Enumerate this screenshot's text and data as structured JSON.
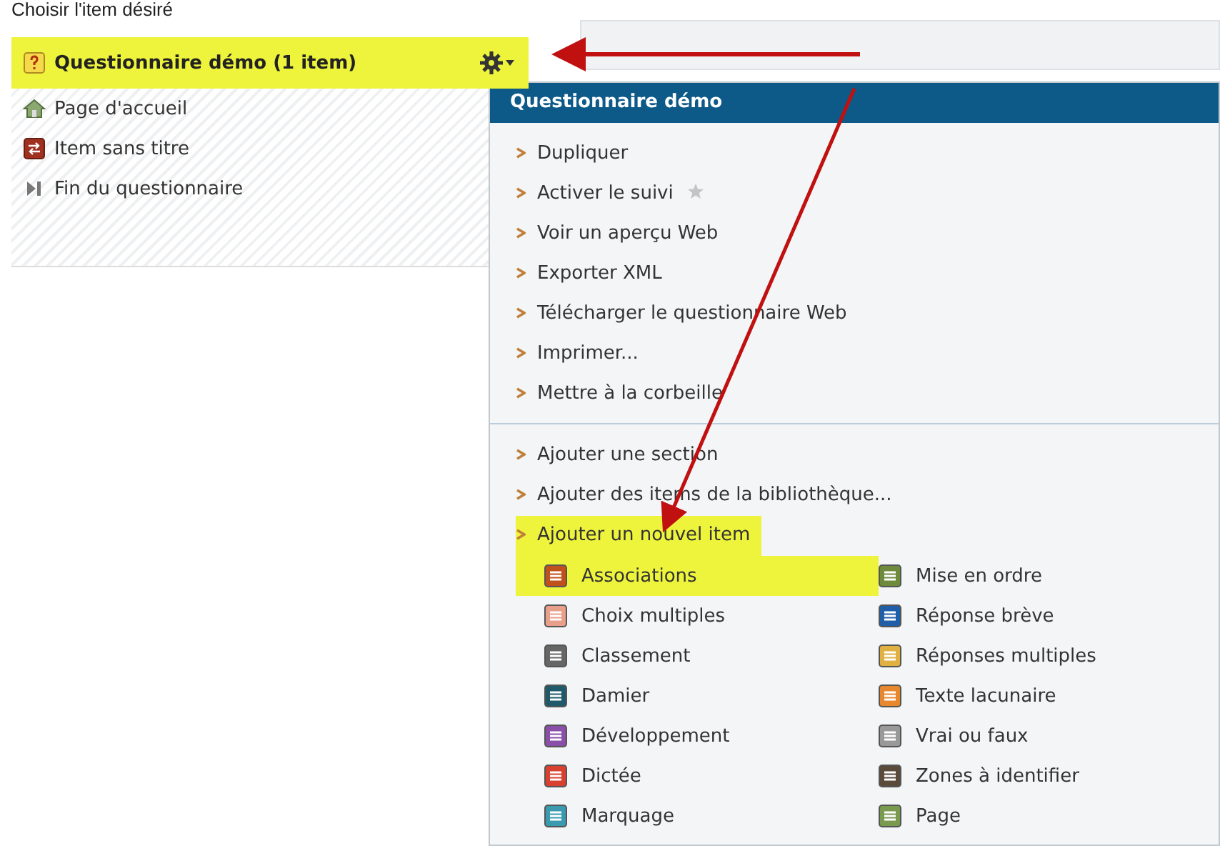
{
  "heading": "Choisir l'item désiré",
  "tree": [
    {
      "label": "Questionnaire démo (1 item)",
      "kind": "quiz",
      "selected": true
    },
    {
      "label": "Page d'accueil",
      "kind": "home",
      "selected": false
    },
    {
      "label": "Item sans titre",
      "kind": "item",
      "selected": false
    },
    {
      "label": "Fin du questionnaire",
      "kind": "end",
      "selected": false
    }
  ],
  "menu": {
    "title": "Questionnaire démo",
    "actions": [
      {
        "label": "Dupliquer",
        "star": false
      },
      {
        "label": "Activer le suivi",
        "star": true
      },
      {
        "label": "Voir un aperçu Web",
        "star": false
      },
      {
        "label": "Exporter XML",
        "star": false
      },
      {
        "label": "Télécharger le questionnaire Web",
        "star": false
      },
      {
        "label": "Imprimer...",
        "star": false
      },
      {
        "label": "Mettre à la corbeille",
        "star": false
      }
    ],
    "add_actions": [
      {
        "label": "Ajouter une section",
        "highlighted": false
      },
      {
        "label": "Ajouter des items de la bibliothèque...",
        "highlighted": false
      },
      {
        "label": "Ajouter un nouvel item",
        "highlighted": true
      }
    ],
    "item_types": [
      {
        "label": "Associations",
        "color": "#c0501c",
        "highlighted": true
      },
      {
        "label": "Mise en ordre",
        "color": "#6e8b3d",
        "highlighted": false
      },
      {
        "label": "Choix multiples",
        "color": "#e8a08a",
        "highlighted": false
      },
      {
        "label": "Réponse brève",
        "color": "#1f5fa8",
        "highlighted": false
      },
      {
        "label": "Classement",
        "color": "#666666",
        "highlighted": false
      },
      {
        "label": "Réponses multiples",
        "color": "#e0b040",
        "highlighted": false
      },
      {
        "label": "Damier",
        "color": "#1f5a6a",
        "highlighted": false
      },
      {
        "label": "Texte lacunaire",
        "color": "#e8882e",
        "highlighted": false
      },
      {
        "label": "Développement",
        "color": "#8a4fa8",
        "highlighted": false
      },
      {
        "label": "Vrai ou faux",
        "color": "#999999",
        "highlighted": false
      },
      {
        "label": "Dictée",
        "color": "#d84030",
        "highlighted": false
      },
      {
        "label": "Zones à identifier",
        "color": "#5a4a3a",
        "highlighted": false
      },
      {
        "label": "Marquage",
        "color": "#3a9ab0",
        "highlighted": false
      },
      {
        "label": "Page",
        "color": "#7a9a50",
        "highlighted": false
      }
    ]
  }
}
